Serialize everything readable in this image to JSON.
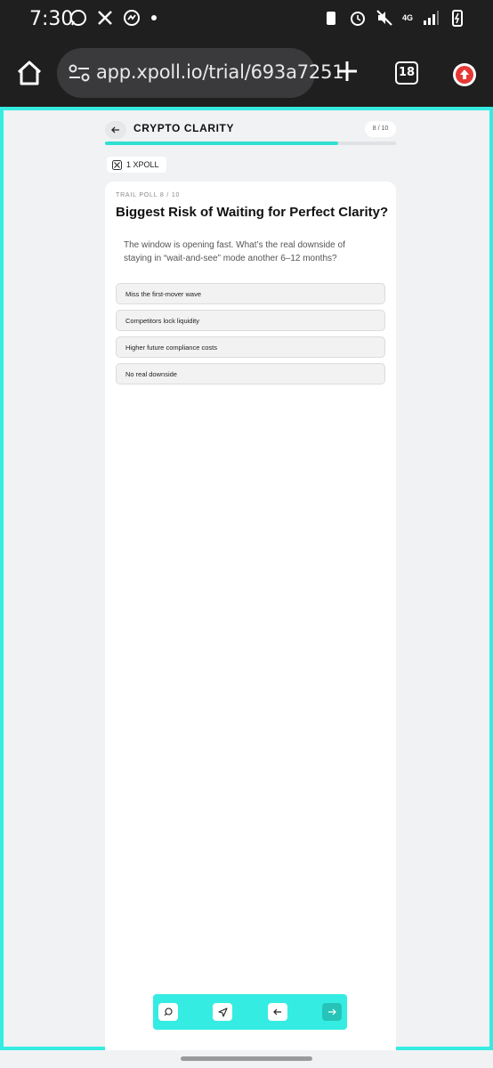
{
  "status_bar": {
    "time": "7:30",
    "left_icons": [
      "whatsapp-icon",
      "x-icon",
      "messenger-icon"
    ],
    "right_icons": [
      "battery-saver-icon",
      "alarm-icon",
      "mute-icon",
      "network-4g-icon",
      "signal-icon",
      "battery-icon"
    ],
    "network_label": "4G"
  },
  "browser": {
    "url": "app.xpoll.io/trial/693a7251",
    "tab_count": "18"
  },
  "poll": {
    "title": "CRYPTO CLARITY",
    "counter": "8 / 10",
    "progress": 0.8,
    "xpoll_badge": "1 XPOLL",
    "eyebrow": "TRAIL POLL 8 / 10",
    "question": "Biggest Risk of Waiting for Perfect Clarity?",
    "description": "The window is opening fast. What’s the real downside of staying in “wait-and-see” mode another 6–12 months?",
    "options": [
      "Miss the first-mover wave",
      "Competitors lock liquidity",
      "Higher future compliance costs",
      "No real downside"
    ]
  },
  "toolbar": {
    "buttons": [
      "comment-icon",
      "send-icon",
      "arrow-left-icon",
      "arrow-right-icon"
    ]
  },
  "colors": {
    "accent": "#35ece2",
    "accent_dark": "#26c4b8",
    "status_bg": "#1f1f1f",
    "page_bg": "#f0f2f4"
  }
}
